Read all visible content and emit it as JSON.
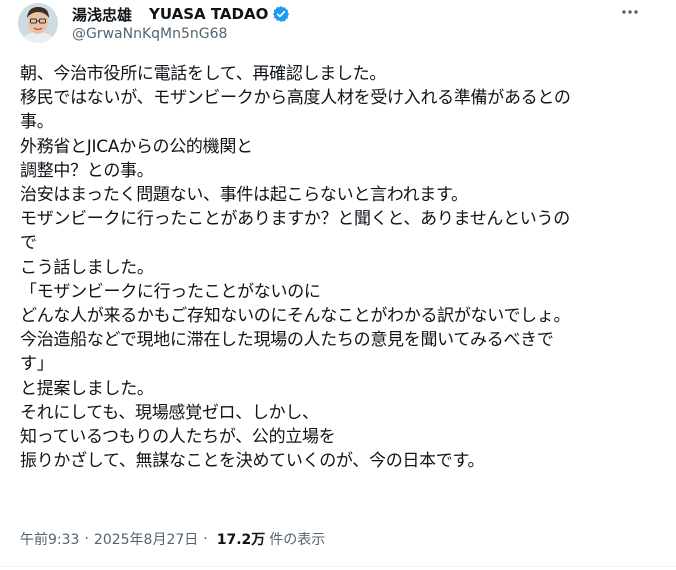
{
  "author": {
    "name": "湯浅忠雄",
    "name_latin": "YUASA TADAO",
    "handle": "@GrwaNnKqMn5nG68",
    "verified_color": "#1d9bf0"
  },
  "tweet": {
    "lines": [
      "朝、今治市役所に電話をして、再確認しました。",
      "移民ではないが、モザンビークから高度人材を受け入れる準備があるとの",
      "事。",
      "外務省とJICAからの公的機関と",
      "調整中？との事。",
      "治安はまったく問題ない、事件は起こらないと言われます。",
      "モザンビークに行ったことがありますか？と聞くと、ありませんというの",
      "で",
      "こう話しました。",
      "「モザンビークに行ったことがないのに",
      "どんな人が来るかもご存知ないのにそんなことがわかる訳がないでしょ。",
      "今治造船などで現地に滞在した現場の人たちの意見を聞いてみるべきで",
      "す」",
      "と提案しました。",
      "それにしても、現場感覚ゼロ、しかし、",
      "知っているつもりの人たちが、公的立場を",
      "振りかざして、無謀なことを決めていくのが、今の日本です。"
    ]
  },
  "meta": {
    "time": "午前9:33",
    "separator": "·",
    "date": "2025年8月27日",
    "views_count": "17.2万",
    "views_label": "件の表示"
  },
  "icons": {
    "more": "more-dots-icon",
    "verified": "verified-badge-icon"
  }
}
